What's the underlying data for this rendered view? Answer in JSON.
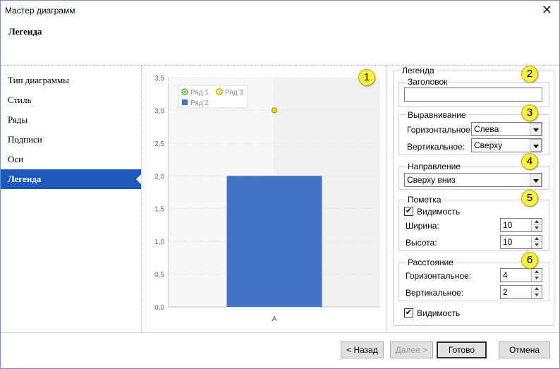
{
  "window": {
    "title": "Мастер диаграмм",
    "close_glyph": "✕"
  },
  "header": {
    "title": "Легенда"
  },
  "nav": {
    "items": [
      {
        "label": "Тип диаграммы"
      },
      {
        "label": "Стиль"
      },
      {
        "label": "Ряды"
      },
      {
        "label": "Подписи"
      },
      {
        "label": "Оси"
      },
      {
        "label": "Легенда",
        "active": true
      }
    ]
  },
  "badges": [
    "1",
    "2",
    "3",
    "4",
    "5",
    "6"
  ],
  "chart_data": {
    "type": "bar",
    "categories": [
      "A"
    ],
    "series": [
      {
        "name": "Ряд 1",
        "kind": "line-marker",
        "values": [
          null
        ],
        "color": "#59b02e"
      },
      {
        "name": "Ряд 2",
        "kind": "bar",
        "values": [
          2.0
        ],
        "color": "#4472c4"
      },
      {
        "name": "Ряд 3",
        "kind": "line-marker",
        "values": [
          3.0
        ],
        "color": "#f2e400"
      }
    ],
    "ylim": [
      0,
      3.5
    ],
    "yticks": [
      "0,0",
      "0,5",
      "1,0",
      "1,5",
      "2,0",
      "2,5",
      "3,0",
      "3,5"
    ],
    "grid": true,
    "legend_position": "top-left"
  },
  "settings": {
    "title": "Легенда",
    "header_group": {
      "title": "Заголовок",
      "value": ""
    },
    "alignment": {
      "title": "Выравнивание",
      "horizontal_label": "Горизонтальное:",
      "horizontal_value": "Слева",
      "vertical_label": "Вертикальное:",
      "vertical_value": "Сверху"
    },
    "direction": {
      "title": "Направление",
      "value": "Сверху вниз"
    },
    "marker": {
      "title": "Пометка",
      "visibility_label": "Видимость",
      "width_label": "Ширина:",
      "width_value": "10",
      "height_label": "Высота:",
      "height_value": "10"
    },
    "spacing": {
      "title": "Расстояние",
      "horizontal_label": "Горизонтальное:",
      "horizontal_value": "4",
      "vertical_label": "Вертикальное:",
      "vertical_value": "2"
    },
    "visibility_label": "Видимость",
    "check_glyph": "✔"
  },
  "buttons": {
    "back": "< Назад",
    "next": "Далее >",
    "finish": "Готово",
    "cancel": "Отмена"
  }
}
